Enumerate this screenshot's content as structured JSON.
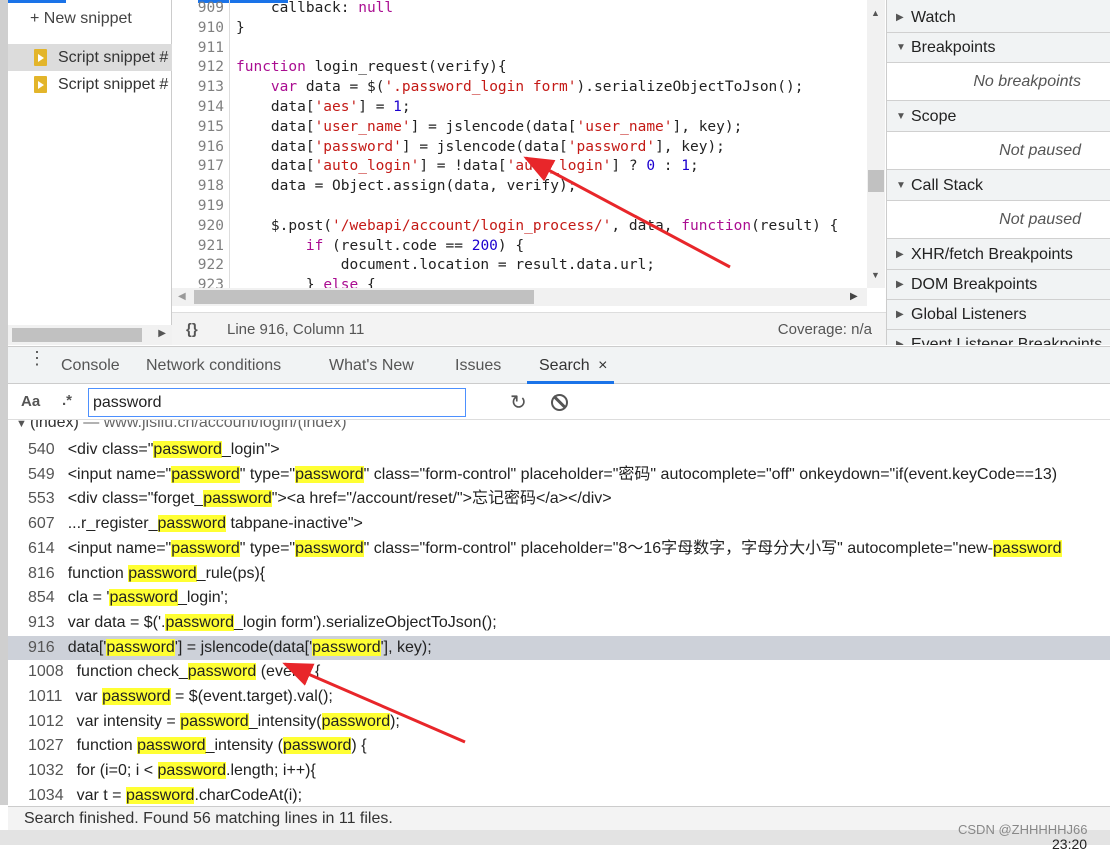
{
  "snippets": {
    "new_label": "+ New snippet",
    "items": [
      "Script snippet #",
      "Script snippet #"
    ]
  },
  "editor": {
    "lines": [
      {
        "n": "909",
        "t": [
          [
            "    callback: ",
            "pl"
          ],
          [
            "null",
            "kw"
          ]
        ]
      },
      {
        "n": "910",
        "t": [
          [
            "}",
            "pl"
          ]
        ]
      },
      {
        "n": "911",
        "t": []
      },
      {
        "n": "912",
        "t": [
          [
            "function",
            "kw"
          ],
          [
            " login_request(verify){",
            "pl"
          ]
        ]
      },
      {
        "n": "913",
        "t": [
          [
            "    ",
            "pl"
          ],
          [
            "var",
            "kw"
          ],
          [
            " data = $(",
            "pl"
          ],
          [
            "'.password_login form'",
            "str"
          ],
          [
            ").serializeObjectToJson();",
            "pl"
          ]
        ]
      },
      {
        "n": "914",
        "t": [
          [
            "    data[",
            "pl"
          ],
          [
            "'aes'",
            "str"
          ],
          [
            "] = ",
            "pl"
          ],
          [
            "1",
            "num"
          ],
          [
            ";",
            "pl"
          ]
        ]
      },
      {
        "n": "915",
        "t": [
          [
            "    data[",
            "pl"
          ],
          [
            "'user_name'",
            "str"
          ],
          [
            "] = jslencode(data[",
            "pl"
          ],
          [
            "'user_name'",
            "str"
          ],
          [
            "], key);",
            "pl"
          ]
        ]
      },
      {
        "n": "916",
        "t": [
          [
            "    data[",
            "pl"
          ],
          [
            "'password'",
            "str"
          ],
          [
            "] = jslencode(data[",
            "pl"
          ],
          [
            "'password'",
            "str"
          ],
          [
            "], key);",
            "pl"
          ]
        ]
      },
      {
        "n": "917",
        "t": [
          [
            "    data[",
            "pl"
          ],
          [
            "'auto_login'",
            "str"
          ],
          [
            "] = !data[",
            "pl"
          ],
          [
            "'auto_login'",
            "str"
          ],
          [
            "] ? ",
            "pl"
          ],
          [
            "0",
            "num"
          ],
          [
            " : ",
            "pl"
          ],
          [
            "1",
            "num"
          ],
          [
            ";",
            "pl"
          ]
        ]
      },
      {
        "n": "918",
        "t": [
          [
            "    data = Object.assign(data, verify);",
            "pl"
          ]
        ]
      },
      {
        "n": "919",
        "t": []
      },
      {
        "n": "920",
        "t": [
          [
            "    $.post(",
            "pl"
          ],
          [
            "'/webapi/account/login_process/'",
            "str"
          ],
          [
            ", data, ",
            "pl"
          ],
          [
            "function",
            "kw"
          ],
          [
            "(result) {",
            "pl"
          ]
        ]
      },
      {
        "n": "921",
        "t": [
          [
            "        ",
            "pl"
          ],
          [
            "if",
            "kw"
          ],
          [
            " (result.code == ",
            "pl"
          ],
          [
            "200",
            "num"
          ],
          [
            ") {",
            "pl"
          ]
        ]
      },
      {
        "n": "922",
        "t": [
          [
            "            document.location = result.data.url;",
            "pl"
          ]
        ]
      },
      {
        "n": "923",
        "t": [
          [
            "        } ",
            "pl"
          ],
          [
            "else",
            "kw"
          ],
          [
            " {",
            "pl"
          ]
        ]
      }
    ],
    "format_icon": "{}",
    "position": "Line 916, Column 11",
    "coverage": "Coverage: n/a"
  },
  "sidebar": {
    "sections": [
      {
        "label": "Watch",
        "open": false
      },
      {
        "label": "Breakpoints",
        "open": true,
        "empty": "No breakpoints"
      },
      {
        "label": "Scope",
        "open": true,
        "empty": "Not paused"
      },
      {
        "label": "Call Stack",
        "open": true,
        "empty": "Not paused"
      },
      {
        "label": "XHR/fetch Breakpoints",
        "open": false
      },
      {
        "label": "DOM Breakpoints",
        "open": false
      },
      {
        "label": "Global Listeners",
        "open": false
      },
      {
        "label": "Event Listener Breakpoints",
        "open": false
      }
    ]
  },
  "drawer": {
    "tabs": [
      "Console",
      "Network conditions",
      "What's New",
      "Issues",
      "Search"
    ],
    "active": "Search",
    "close": "×"
  },
  "search": {
    "case_label": "Aa",
    "regex_label": ".*",
    "query": "password"
  },
  "results": {
    "file": "(index)",
    "sep": " — ",
    "url": "www.jisilu.cn/account/login/(index)",
    "rows": [
      {
        "n": "540",
        "s": [
          [
            "<div class=\"",
            0
          ],
          [
            "password",
            1
          ],
          [
            "_login\">",
            0
          ]
        ]
      },
      {
        "n": "549",
        "s": [
          [
            "<input name=\"",
            0
          ],
          [
            "password",
            1
          ],
          [
            "\" type=\"",
            0
          ],
          [
            "password",
            1
          ],
          [
            "\" class=\"form-control\" placeholder=\"密码\" autocomplete=\"off\" onkeydown=\"if(event.keyCode==13)",
            0
          ]
        ]
      },
      {
        "n": "553",
        "s": [
          [
            "<div class=\"forget_",
            0
          ],
          [
            "password",
            1
          ],
          [
            "\"><a href=\"/account/reset/\">忘记密码</a></div>",
            0
          ]
        ]
      },
      {
        "n": "607",
        "s": [
          [
            "...r_register_",
            0
          ],
          [
            "password",
            1
          ],
          [
            " tabpane-inactive\">",
            0
          ]
        ]
      },
      {
        "n": "614",
        "s": [
          [
            "<input name=\"",
            0
          ],
          [
            "password",
            1
          ],
          [
            "\" type=\"",
            0
          ],
          [
            "password",
            1
          ],
          [
            "\" class=\"form-control\" placeholder=\"8～16字母数字，字母分大小写\" autocomplete=\"new-",
            0
          ],
          [
            "password",
            1
          ]
        ]
      },
      {
        "n": "816",
        "s": [
          [
            "function ",
            0
          ],
          [
            "password",
            1
          ],
          [
            "_rule(ps){",
            0
          ]
        ]
      },
      {
        "n": "854",
        "s": [
          [
            "cla = '",
            0
          ],
          [
            "password",
            1
          ],
          [
            "_login';",
            0
          ]
        ]
      },
      {
        "n": "913",
        "s": [
          [
            "var data = $('.",
            0
          ],
          [
            "password",
            1
          ],
          [
            "_login form').serializeObjectToJson();",
            0
          ]
        ]
      },
      {
        "n": "916",
        "sel": true,
        "s": [
          [
            "data['",
            0
          ],
          [
            "password",
            1
          ],
          [
            "'] = jslencode(data['",
            0
          ],
          [
            "password",
            1
          ],
          [
            "'], key);",
            0
          ]
        ]
      },
      {
        "n": "1008",
        "s": [
          [
            "function check_",
            0
          ],
          [
            "password",
            1
          ],
          [
            " (event) {",
            0
          ]
        ]
      },
      {
        "n": "1011",
        "s": [
          [
            "var ",
            0
          ],
          [
            "password",
            1
          ],
          [
            " = $(event.target).val();",
            0
          ]
        ]
      },
      {
        "n": "1012",
        "s": [
          [
            "var intensity = ",
            0
          ],
          [
            "password",
            1
          ],
          [
            "_intensity(",
            0
          ],
          [
            "password",
            1
          ],
          [
            ");",
            0
          ]
        ]
      },
      {
        "n": "1027",
        "s": [
          [
            "function ",
            0
          ],
          [
            "password",
            1
          ],
          [
            "_intensity (",
            0
          ],
          [
            "password",
            1
          ],
          [
            ") {",
            0
          ]
        ]
      },
      {
        "n": "1032",
        "s": [
          [
            "for (i=0; i < ",
            0
          ],
          [
            "password",
            1
          ],
          [
            ".length; i++){",
            0
          ]
        ]
      },
      {
        "n": "1034",
        "s": [
          [
            "var t = ",
            0
          ],
          [
            "password",
            1
          ],
          [
            ".charCodeAt(i);",
            0
          ]
        ]
      }
    ],
    "status": "Search finished.  Found 56 matching lines in 11 files."
  },
  "watermark": "CSDN @ZHHHHHJ66",
  "clock": "23:20",
  "colors": {
    "accent": "#1a73e8",
    "highlight": "#ffff33",
    "annotation_arrow": "#e8262a"
  }
}
